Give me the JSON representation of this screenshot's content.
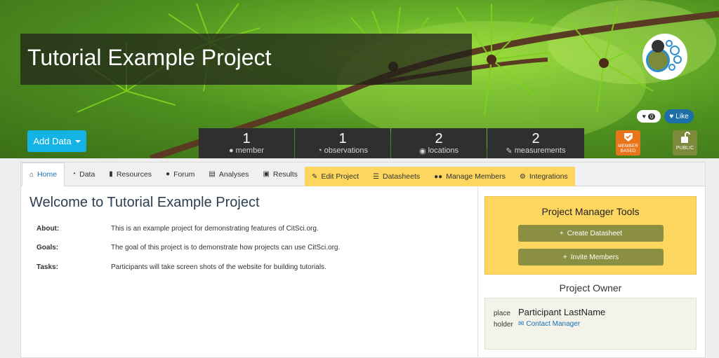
{
  "project": {
    "title": "Tutorial Example Project",
    "favorite_count": "0",
    "like_label": "Like",
    "add_data_label": "Add Data",
    "member_badge": "MEMBER BASED",
    "public_badge": "PUBLIC"
  },
  "stats": [
    {
      "value": "1",
      "label": "member",
      "icon": "user-icon"
    },
    {
      "value": "1",
      "label": "observations",
      "icon": "binoculars-icon"
    },
    {
      "value": "2",
      "label": "locations",
      "icon": "map-marker-icon"
    },
    {
      "value": "2",
      "label": "measurements",
      "icon": "pencil-icon"
    }
  ],
  "tabs": [
    {
      "label": "Home",
      "icon": "home-icon"
    },
    {
      "label": "Data",
      "icon": "binoculars-icon"
    },
    {
      "label": "Resources",
      "icon": "file-icon"
    },
    {
      "label": "Forum",
      "icon": "comments-icon"
    },
    {
      "label": "Analyses",
      "icon": "chart-icon"
    },
    {
      "label": "Results",
      "icon": "newspaper-icon"
    },
    {
      "label": "Edit Project",
      "icon": "pencil-icon"
    },
    {
      "label": "Datasheets",
      "icon": "list-icon"
    },
    {
      "label": "Manage Members",
      "icon": "users-icon"
    },
    {
      "label": "Integrations",
      "icon": "cogs-icon"
    }
  ],
  "main": {
    "welcome": "Welcome to Tutorial Example Project",
    "about_label": "About:",
    "about_value": "This is an example project for demonstrating features of CitSci.org.",
    "goals_label": "Goals:",
    "goals_value": "The goal of this project is to demonstrate how projects can use CitSci.org.",
    "tasks_label": "Tasks:",
    "tasks_value": "Participants will take screen shots of the website for building tutorials."
  },
  "sidebar": {
    "tools_title": "Project Manager Tools",
    "create_datasheet": "Create Datasheet",
    "invite_members": "Invite Members",
    "owner_title": "Project Owner",
    "owner_placeholder": "placeholder",
    "owner_name": "Participant LastName",
    "contact_label": "Contact Manager"
  },
  "colors": {
    "accent": "#14b3e6",
    "manager_tab": "#fdd65f",
    "tool_button": "#8a8f42",
    "member_badge": "#e8741c",
    "public_badge": "#7c8a3c",
    "like": "#1d6fa8"
  }
}
